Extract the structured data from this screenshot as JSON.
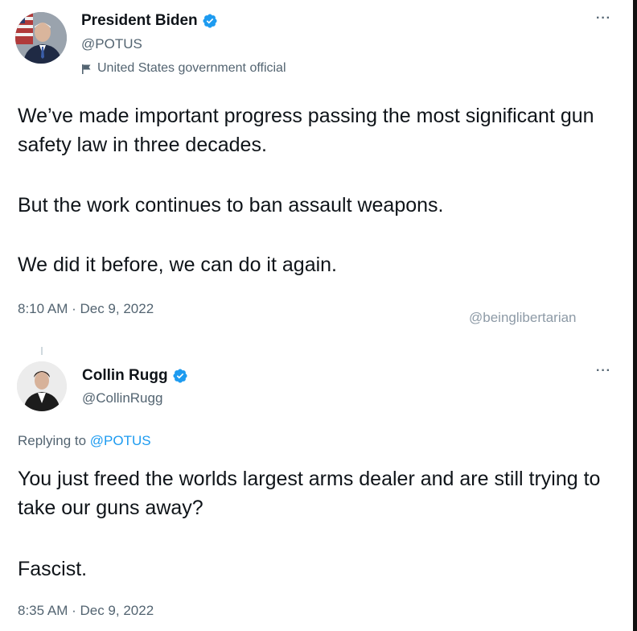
{
  "tweets": [
    {
      "name": "President Biden",
      "handle": "@POTUS",
      "label": "United States government official",
      "text": [
        "We’ve made important progress passing the most significant gun safety law in three decades.",
        "But the work continues to ban assault weapons.",
        "We did it before, we can do it again."
      ],
      "timestamp": "8:10 AM · Dec 9, 2022",
      "more": "···"
    },
    {
      "name": "Collin Rugg",
      "handle": "@CollinRugg",
      "replying_prefix": "Replying to ",
      "replying_to": "@POTUS",
      "text": [
        "You just freed the worlds largest arms dealer and are still trying to take our guns away?",
        "Fascist."
      ],
      "timestamp": "8:35 AM · Dec 9, 2022",
      "more": "···"
    }
  ],
  "watermark": "@beinglibertarian",
  "colors": {
    "verified": "#1d9bf0",
    "text": "#0f1419",
    "secondary": "#536471",
    "link": "#1d9bf0"
  }
}
